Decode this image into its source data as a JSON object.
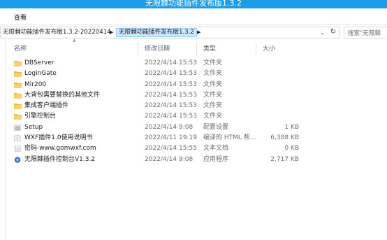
{
  "window": {
    "title": "无限棘功能插件发布版1.3.2"
  },
  "ribbon": {
    "view_tab": "查看"
  },
  "address": {
    "crumbs": [
      "无限棘功能插件发布版1.3.2-20220414",
      "无限棘功能插件发布版1.3.2"
    ],
    "dropdown_glyph": "⌄",
    "refresh_glyph": "↻",
    "search_placeholder": "搜索\"无限棘"
  },
  "columns": {
    "name": "名称",
    "date": "修改日期",
    "type": "类型",
    "size": "大小"
  },
  "files": [
    {
      "name": "DBServer",
      "date": "2022/4/14 15:53",
      "type": "文件夹",
      "size": "",
      "icon": "folder-icon"
    },
    {
      "name": "LoginGate",
      "date": "2022/4/14 15:53",
      "type": "文件夹",
      "size": "",
      "icon": "folder-icon"
    },
    {
      "name": "Mir200",
      "date": "2022/4/14 15:53",
      "type": "文件夹",
      "size": "",
      "icon": "folder-icon"
    },
    {
      "name": "大背包需要替换的其他文件",
      "date": "2022/4/14 15:53",
      "type": "文件夹",
      "size": "",
      "icon": "folder-icon"
    },
    {
      "name": "集成客户端插件",
      "date": "2022/4/14 15:53",
      "type": "文件夹",
      "size": "",
      "icon": "folder-icon"
    },
    {
      "name": "引擎控制台",
      "date": "2022/4/14 15:53",
      "type": "文件夹",
      "size": "",
      "icon": "folder-icon"
    },
    {
      "name": "Setup",
      "date": "2022/4/14 9:08",
      "type": "配置设置",
      "size": "1 KB",
      "icon": "settings-file-icon"
    },
    {
      "name": "WXF插件1.0使用说明书",
      "date": "2022/4/11 19:19",
      "type": "编译的 HTML 帮...",
      "size": "6,388 KB",
      "icon": "help-file-icon"
    },
    {
      "name": "密码-www.gomwxf.com",
      "date": "2022/4/14 15:55",
      "type": "文本文档",
      "size": "0 KB",
      "icon": "text-file-icon"
    },
    {
      "name": "无限棘插件控制台V1.3.2",
      "date": "2022/4/14 9:08",
      "type": "应用程序",
      "size": "2,717 KB",
      "icon": "app-icon"
    }
  ]
}
